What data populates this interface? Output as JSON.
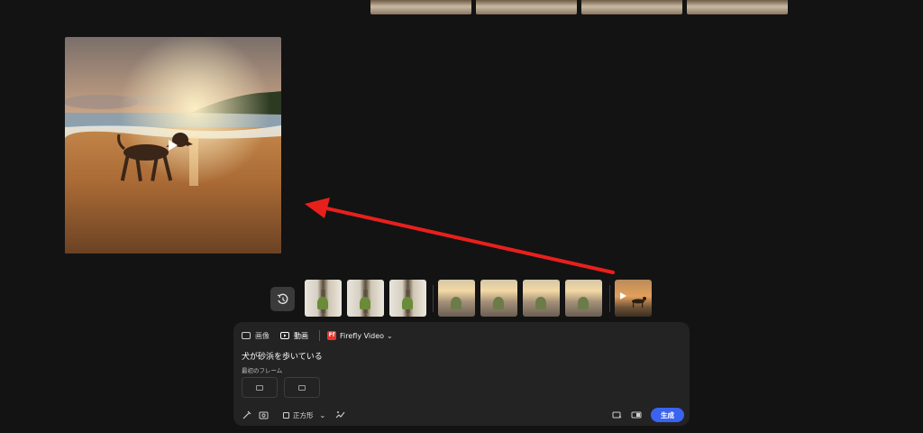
{
  "top_strip": {
    "thumb_count": 4
  },
  "preview": {
    "kind": "video",
    "alt": "dog walking on beach at sunset"
  },
  "history": {
    "icon": "history-icon"
  },
  "thumbnails": {
    "group1": [
      "plant-stand",
      "plant-stand",
      "plant-stand"
    ],
    "group2": [
      "street-sunset",
      "street-sunset",
      "street-sunset",
      "street-sunset"
    ],
    "latest": "dog-beach-video"
  },
  "panel": {
    "tabs": [
      {
        "label": "画像",
        "icon": "image-icon",
        "active": false
      },
      {
        "label": "動画",
        "icon": "video-icon",
        "active": true
      }
    ],
    "model": {
      "logo": "Ff",
      "name": "Firefly Video"
    },
    "prompt": "犬が砂浜を歩いている",
    "first_frame_label": "最初のフレーム",
    "aspect_label": "正方形",
    "generate_label": "生成"
  },
  "colors": {
    "accent": "#3b63f1",
    "arrow": "#e8201c",
    "background": "#131313",
    "panel": "#232323"
  }
}
